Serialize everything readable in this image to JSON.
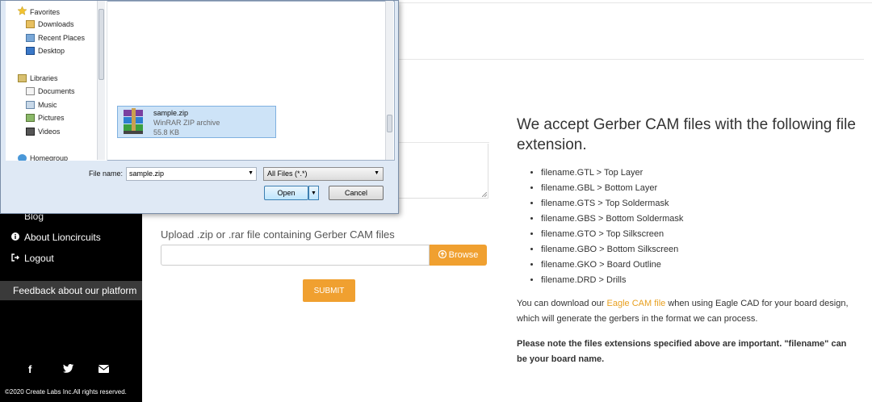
{
  "sidebar": {
    "items": [
      {
        "label": "Blog",
        "icon": "blog-icon"
      },
      {
        "label": "About Lioncircuits",
        "icon": "info-circle-icon"
      },
      {
        "label": "Logout",
        "icon": "logout-icon"
      }
    ],
    "feedback_label": "Feedback about our platform",
    "social": {
      "facebook": "f",
      "twitter": "🐦",
      "email": "✉"
    },
    "copyright": "©2020 Create Labs Inc.All rights reserved."
  },
  "upload": {
    "label": "Upload .zip or .rar file containing Gerber CAM files",
    "file_value": "",
    "browse_label": "Browse",
    "submit_label": "SUBMIT"
  },
  "info": {
    "heading": "We accept Gerber CAM files with the following file extension.",
    "extensions": [
      "filename.GTL > Top Layer",
      "filename.GBL > Bottom Layer",
      "filename.GTS > Top Soldermask",
      "filename.GBS > Bottom Soldermask",
      "filename.GTO > Top Silkscreen",
      "filename.GBO > Bottom Silkscreen",
      "filename.GKO > Board Outline",
      "filename.DRD > Drills"
    ],
    "download_prefix": "You can download our ",
    "download_link": "Eagle CAM file",
    "download_suffix": " when using Eagle CAD for your board design, which will generate the gerbers in the format we can process.",
    "note": "Please note the files extensions specified above are important. \"filename\" can be your board name."
  },
  "dialog": {
    "nav": {
      "favorites": "Favorites",
      "downloads": "Downloads",
      "recent_places": "Recent Places",
      "desktop": "Desktop",
      "libraries": "Libraries",
      "documents": "Documents",
      "music": "Music",
      "pictures": "Pictures",
      "videos": "Videos",
      "homegroup": "Homegroup"
    },
    "file": {
      "name": "sample.zip",
      "type": "WinRAR ZIP archive",
      "size": "55.8 KB"
    },
    "file_name_label": "File name:",
    "file_name_value": "sample.zip",
    "filter_value": "All Files (*.*)",
    "open_label": "Open",
    "cancel_label": "Cancel"
  }
}
